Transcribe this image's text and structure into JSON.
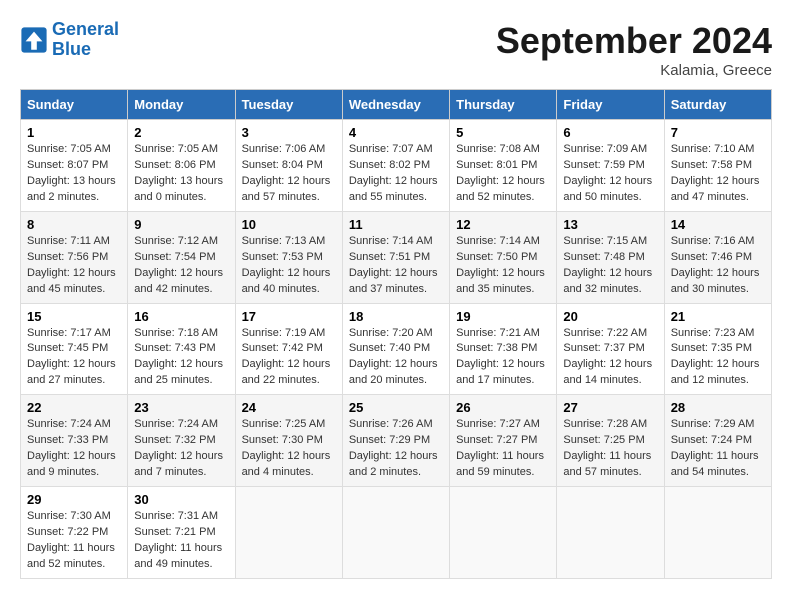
{
  "header": {
    "logo_line1": "General",
    "logo_line2": "Blue",
    "month": "September 2024",
    "location": "Kalamia, Greece"
  },
  "weekdays": [
    "Sunday",
    "Monday",
    "Tuesday",
    "Wednesday",
    "Thursday",
    "Friday",
    "Saturday"
  ],
  "weeks": [
    [
      {
        "day": 1,
        "info": "Sunrise: 7:05 AM\nSunset: 8:07 PM\nDaylight: 13 hours and 2 minutes."
      },
      {
        "day": 2,
        "info": "Sunrise: 7:05 AM\nSunset: 8:06 PM\nDaylight: 13 hours and 0 minutes."
      },
      {
        "day": 3,
        "info": "Sunrise: 7:06 AM\nSunset: 8:04 PM\nDaylight: 12 hours and 57 minutes."
      },
      {
        "day": 4,
        "info": "Sunrise: 7:07 AM\nSunset: 8:02 PM\nDaylight: 12 hours and 55 minutes."
      },
      {
        "day": 5,
        "info": "Sunrise: 7:08 AM\nSunset: 8:01 PM\nDaylight: 12 hours and 52 minutes."
      },
      {
        "day": 6,
        "info": "Sunrise: 7:09 AM\nSunset: 7:59 PM\nDaylight: 12 hours and 50 minutes."
      },
      {
        "day": 7,
        "info": "Sunrise: 7:10 AM\nSunset: 7:58 PM\nDaylight: 12 hours and 47 minutes."
      }
    ],
    [
      {
        "day": 8,
        "info": "Sunrise: 7:11 AM\nSunset: 7:56 PM\nDaylight: 12 hours and 45 minutes."
      },
      {
        "day": 9,
        "info": "Sunrise: 7:12 AM\nSunset: 7:54 PM\nDaylight: 12 hours and 42 minutes."
      },
      {
        "day": 10,
        "info": "Sunrise: 7:13 AM\nSunset: 7:53 PM\nDaylight: 12 hours and 40 minutes."
      },
      {
        "day": 11,
        "info": "Sunrise: 7:14 AM\nSunset: 7:51 PM\nDaylight: 12 hours and 37 minutes."
      },
      {
        "day": 12,
        "info": "Sunrise: 7:14 AM\nSunset: 7:50 PM\nDaylight: 12 hours and 35 minutes."
      },
      {
        "day": 13,
        "info": "Sunrise: 7:15 AM\nSunset: 7:48 PM\nDaylight: 12 hours and 32 minutes."
      },
      {
        "day": 14,
        "info": "Sunrise: 7:16 AM\nSunset: 7:46 PM\nDaylight: 12 hours and 30 minutes."
      }
    ],
    [
      {
        "day": 15,
        "info": "Sunrise: 7:17 AM\nSunset: 7:45 PM\nDaylight: 12 hours and 27 minutes."
      },
      {
        "day": 16,
        "info": "Sunrise: 7:18 AM\nSunset: 7:43 PM\nDaylight: 12 hours and 25 minutes."
      },
      {
        "day": 17,
        "info": "Sunrise: 7:19 AM\nSunset: 7:42 PM\nDaylight: 12 hours and 22 minutes."
      },
      {
        "day": 18,
        "info": "Sunrise: 7:20 AM\nSunset: 7:40 PM\nDaylight: 12 hours and 20 minutes."
      },
      {
        "day": 19,
        "info": "Sunrise: 7:21 AM\nSunset: 7:38 PM\nDaylight: 12 hours and 17 minutes."
      },
      {
        "day": 20,
        "info": "Sunrise: 7:22 AM\nSunset: 7:37 PM\nDaylight: 12 hours and 14 minutes."
      },
      {
        "day": 21,
        "info": "Sunrise: 7:23 AM\nSunset: 7:35 PM\nDaylight: 12 hours and 12 minutes."
      }
    ],
    [
      {
        "day": 22,
        "info": "Sunrise: 7:24 AM\nSunset: 7:33 PM\nDaylight: 12 hours and 9 minutes."
      },
      {
        "day": 23,
        "info": "Sunrise: 7:24 AM\nSunset: 7:32 PM\nDaylight: 12 hours and 7 minutes."
      },
      {
        "day": 24,
        "info": "Sunrise: 7:25 AM\nSunset: 7:30 PM\nDaylight: 12 hours and 4 minutes."
      },
      {
        "day": 25,
        "info": "Sunrise: 7:26 AM\nSunset: 7:29 PM\nDaylight: 12 hours and 2 minutes."
      },
      {
        "day": 26,
        "info": "Sunrise: 7:27 AM\nSunset: 7:27 PM\nDaylight: 11 hours and 59 minutes."
      },
      {
        "day": 27,
        "info": "Sunrise: 7:28 AM\nSunset: 7:25 PM\nDaylight: 11 hours and 57 minutes."
      },
      {
        "day": 28,
        "info": "Sunrise: 7:29 AM\nSunset: 7:24 PM\nDaylight: 11 hours and 54 minutes."
      }
    ],
    [
      {
        "day": 29,
        "info": "Sunrise: 7:30 AM\nSunset: 7:22 PM\nDaylight: 11 hours and 52 minutes."
      },
      {
        "day": 30,
        "info": "Sunrise: 7:31 AM\nSunset: 7:21 PM\nDaylight: 11 hours and 49 minutes."
      },
      null,
      null,
      null,
      null,
      null
    ]
  ]
}
